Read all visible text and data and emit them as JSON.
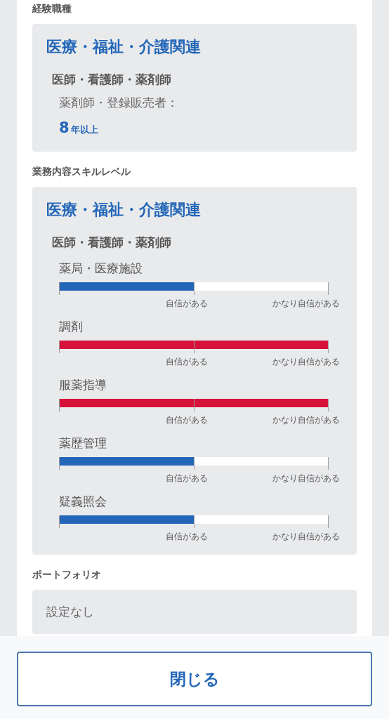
{
  "experience": {
    "label": "経験職種",
    "category": "医療・福祉・介護関連",
    "subcategory": "医師・看護師・薬剤師",
    "job": "薬剤師・登録販売者：",
    "years": "8",
    "years_unit": "年以上"
  },
  "skills": {
    "label": "業務内容スキルレベル",
    "category": "医療・福祉・介護関連",
    "subcategory": "医師・看護師・薬剤師",
    "items": [
      {
        "name": "薬局・医療施設",
        "level": 0.5,
        "color": "#2366b8",
        "ticks": [
          "自信がある",
          "かなり自信がある"
        ]
      },
      {
        "name": "調剤",
        "level": 1,
        "color": "#d6113a",
        "ticks": [
          "自信がある",
          "かなり自信がある"
        ]
      },
      {
        "name": "服薬指導",
        "level": 1,
        "color": "#d6113a",
        "ticks": [
          "自信がある",
          "かなり自信がある"
        ]
      },
      {
        "name": "薬歴管理",
        "level": 0.5,
        "color": "#2366b8",
        "ticks": [
          "自信がある",
          "かなり自信がある"
        ]
      },
      {
        "name": "疑義照会",
        "level": 0.5,
        "color": "#2366b8",
        "ticks": [
          "自信がある",
          "かなり自信がある"
        ]
      }
    ]
  },
  "portfolio": {
    "label": "ポートフォリオ",
    "value": "設定なし"
  },
  "close_button": "閉じる"
}
